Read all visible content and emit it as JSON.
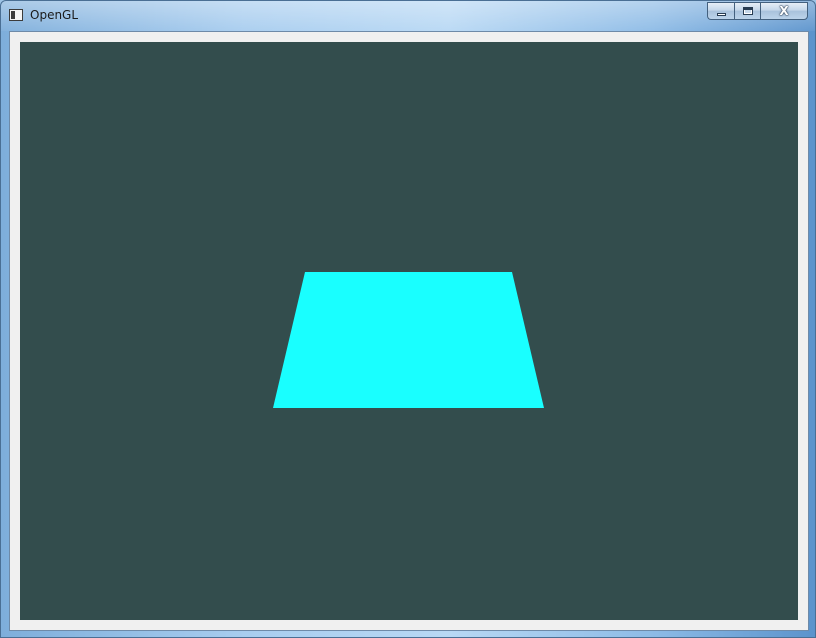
{
  "window": {
    "title": "OpenGL",
    "icon": "application-icon",
    "controls": {
      "minimize": "minimize-icon",
      "maximize": "maximize-icon",
      "close": "close-icon",
      "close_glyph": "X"
    }
  },
  "viewport": {
    "clear_color": "#334d4d",
    "shape": {
      "type": "trapezoid",
      "fill": "#19ffff"
    }
  }
}
